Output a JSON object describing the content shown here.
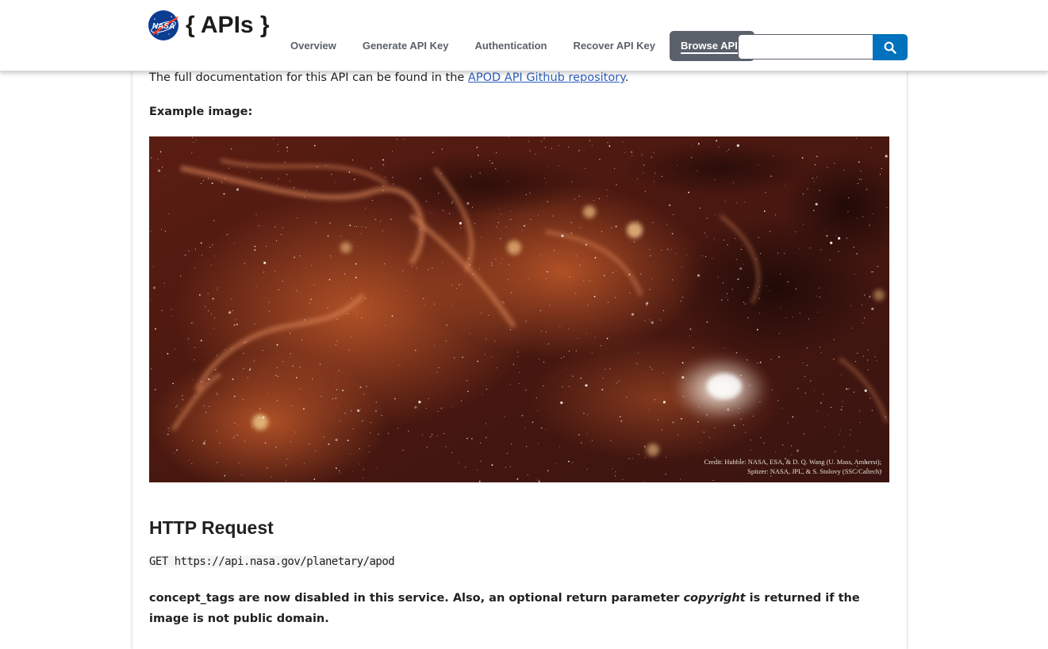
{
  "header": {
    "brand": "{ APIs }",
    "logo_icon": "nasa-meatball-logo",
    "nav": [
      {
        "label": "Overview"
      },
      {
        "label": "Generate API Key"
      },
      {
        "label": "Authentication"
      },
      {
        "label": "Recover API Key"
      },
      {
        "label": "Browse APIs",
        "active": true
      }
    ],
    "search": {
      "value": "",
      "placeholder": "",
      "icon": "search-icon"
    }
  },
  "content": {
    "doc_text_before": "The full documentation for this API can be found in the ",
    "doc_link": "APOD API Github repository",
    "doc_text_after": ".",
    "example_label": "Example image:",
    "image_credit_line1": "Credit: Hubble: NASA, ESA, & D. Q. Wang (U. Mass, Amherst);",
    "image_credit_line2": "Spitzer: NASA, JPL, & S. Stolovy (SSC/Caltech)",
    "http_heading": "HTTP Request",
    "http_request": "GET https://api.nasa.gov/planetary/apod",
    "notice_part1": "concept_tags are now disabled in this service. Also, an optional return parameter ",
    "notice_em": "copyright",
    "notice_part2": " is returned if the image is not public domain."
  },
  "colors": {
    "accent": "#0071bc",
    "nav_active_bg": "#5b616b",
    "link": "#2e5fbd"
  }
}
